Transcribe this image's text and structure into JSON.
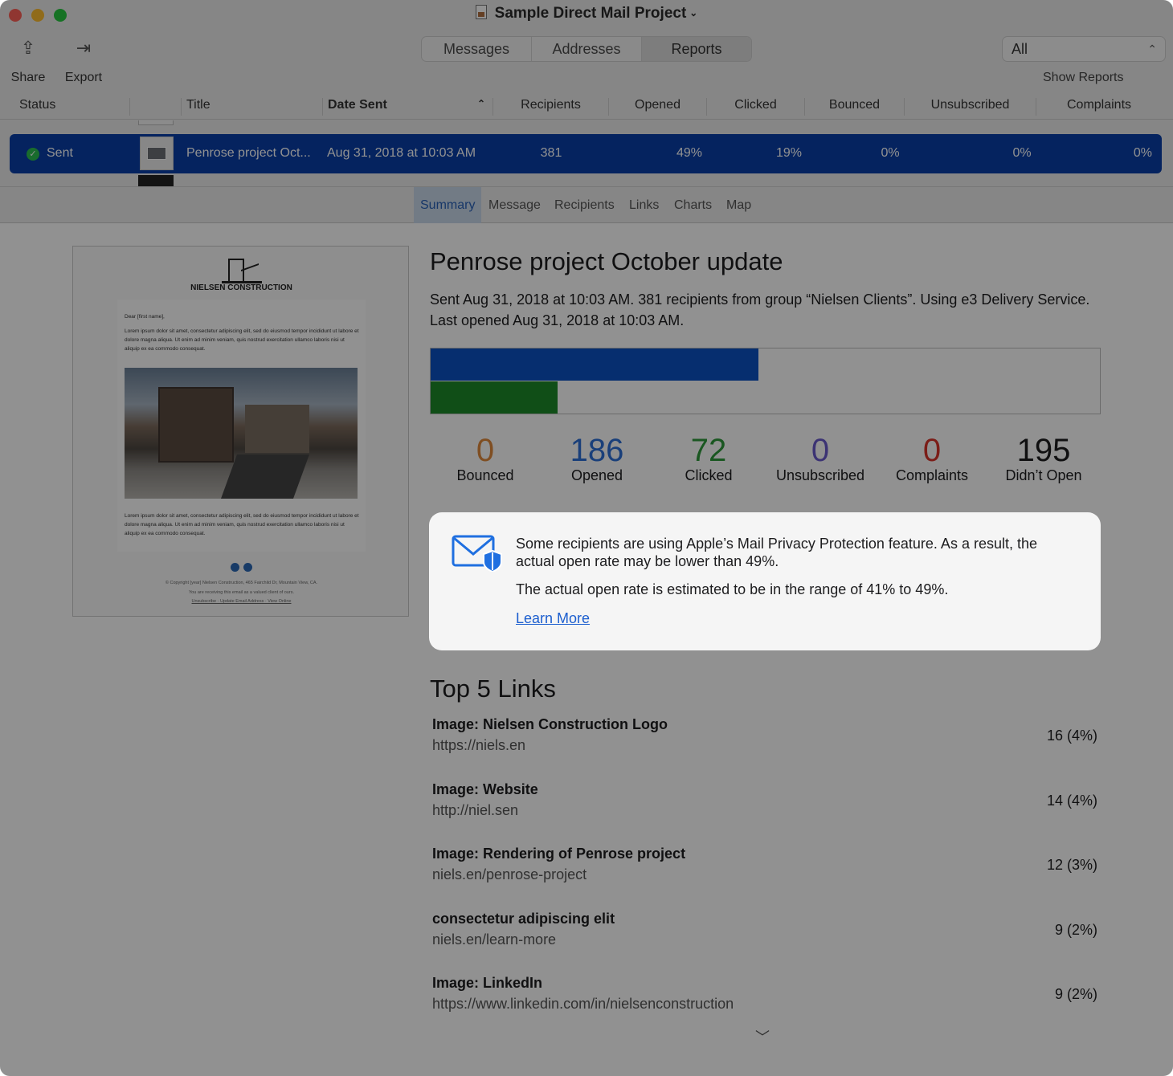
{
  "window": {
    "title": "Sample Direct Mail Project"
  },
  "toolbar": {
    "share_label": "Share",
    "export_label": "Export",
    "show_reports_label": "Show Reports"
  },
  "tabs": [
    "Messages",
    "Addresses",
    "Reports"
  ],
  "filter": {
    "value": "All"
  },
  "table": {
    "headers": [
      "Status",
      "Title",
      "Date Sent",
      "Recipients",
      "Opened",
      "Clicked",
      "Bounced",
      "Unsubscribed",
      "Complaints"
    ],
    "selected_row": {
      "status": "Sent",
      "title": "Penrose project Oct...",
      "date": "Aug 31, 2018 at 10:03 AM",
      "recipients": "381",
      "opened": "49%",
      "clicked": "19%",
      "bounced": "0%",
      "unsubscribed": "0%",
      "complaints": "0%"
    }
  },
  "subtabs": [
    "Summary",
    "Message",
    "Recipients",
    "Links",
    "Charts",
    "Map"
  ],
  "preview": {
    "company": "NIELSEN CONSTRUCTION",
    "greeting": "Dear [first name],",
    "para1": "Lorem ipsum dolor sit amet, consectetur adipiscing elit, sed do eiusmod tempor incididunt ut labore et dolore magna aliqua. Ut enim ad minim veniam, quis nostrud exercitation ullamco laboris nisi ut aliquip ex ea commodo consequat.",
    "para2": "Lorem ipsum dolor sit amet, consectetur adipiscing elit, sed do eiusmod tempor incididunt ut labore et dolore magna aliqua. Ut enim ad minim veniam, quis nostrud exercitation ullamco laboris nisi ut aliquip ex ea commodo consequat.",
    "footer1": "© Copyright [year] Nielsen Construction, 465 Fairchild Dr, Mountain View, CA.",
    "footer2": "You are receiving this email as a valued client of ours.",
    "footer3": "Unsubscribe · Update Email Address · View Online"
  },
  "summary": {
    "title": "Penrose project October update",
    "description": "Sent Aug 31, 2018 at 10:03 AM. 381 recipients from group “Nielsen Clients”. Using e3 Delivery Service. Last opened Aug 31, 2018 at 10:03 AM.",
    "opened_fraction": 0.49,
    "clicked_fraction": 0.19,
    "stats": [
      {
        "value": "0",
        "label": "Bounced",
        "color": "#e08a3c"
      },
      {
        "value": "186",
        "label": "Opened",
        "color": "#2c6fd6"
      },
      {
        "value": "72",
        "label": "Clicked",
        "color": "#2f9a3a"
      },
      {
        "value": "0",
        "label": "Unsubscribed",
        "color": "#6a5acd"
      },
      {
        "value": "0",
        "label": "Complaints",
        "color": "#d9342b"
      },
      {
        "value": "195",
        "label": "Didn’t Open",
        "color": "#1d1d1f"
      }
    ]
  },
  "notice": {
    "line1": "Some recipients are using Apple’s Mail Privacy Protection feature. As a result, the actual open rate may be lower than 49%.",
    "line2": "The actual open rate is estimated to be in the range of 41% to 49%.",
    "link": "Learn More"
  },
  "links": {
    "title": "Top 5 Links",
    "items": [
      {
        "title": "Image: Nielsen Construction Logo",
        "url": "https://niels.en",
        "count": "16 (4%)"
      },
      {
        "title": "Image: Website",
        "url": "http://niel.sen",
        "count": "14 (4%)"
      },
      {
        "title": "Image: Rendering of Penrose project",
        "url": "niels.en/penrose-project",
        "count": "12 (3%)"
      },
      {
        "title": "consectetur adipiscing elit",
        "url": "niels.en/learn-more",
        "count": "9 (2%)"
      },
      {
        "title": "Image: LinkedIn",
        "url": "https://www.linkedin.com/in/nielsenconstruction",
        "count": "9 (2%)"
      }
    ]
  }
}
